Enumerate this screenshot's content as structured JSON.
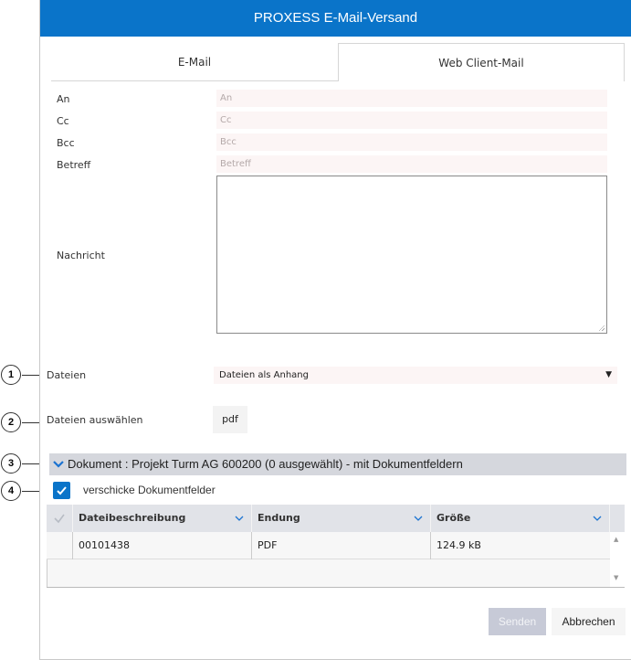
{
  "dialog": {
    "title": "PROXESS E-Mail-Versand"
  },
  "tabs": [
    {
      "label": "E-Mail",
      "active": false
    },
    {
      "label": "Web Client-Mail",
      "active": true
    }
  ],
  "form": {
    "to": {
      "label": "An",
      "placeholder": "An",
      "value": ""
    },
    "cc": {
      "label": "Cc",
      "placeholder": "Cc",
      "value": ""
    },
    "bcc": {
      "label": "Bcc",
      "placeholder": "Bcc",
      "value": ""
    },
    "subject": {
      "label": "Betreff",
      "placeholder": "Betreff",
      "value": ""
    },
    "message": {
      "label": "Nachricht",
      "value": ""
    }
  },
  "files": {
    "label": "Dateien",
    "mode_selected": "Dateien als Anhang",
    "arrow": "▼",
    "select_label": "Dateien auswählen",
    "type_button": "pdf"
  },
  "document_section": {
    "expanded": true,
    "title": "Dokument : Projekt Turm AG 600200 (0 ausgewählt) - mit Dokumentfeldern",
    "send_fields_label": "verschicke Dokumentfelder",
    "send_fields_checked": true
  },
  "grid": {
    "columns": [
      "Dateibeschreibung",
      "Endung",
      "Größe"
    ],
    "rows": [
      {
        "description": "00101438",
        "extension": "PDF",
        "size": "124.9 kB"
      }
    ]
  },
  "buttons": {
    "send": "Senden",
    "cancel": "Abbrechen"
  },
  "callouts": [
    "1",
    "2",
    "3",
    "4"
  ],
  "colors": {
    "accent": "#0a74c9",
    "section_bg": "#d5d7dd",
    "input_bg": "#fcf5f5"
  }
}
